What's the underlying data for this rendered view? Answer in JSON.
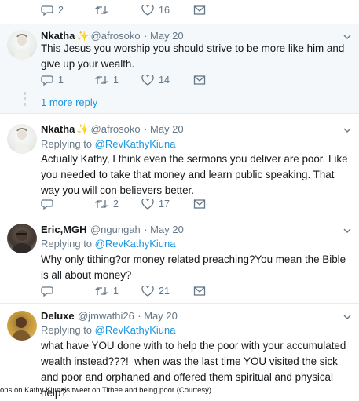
{
  "top_actions": {
    "replies": "2",
    "likes": "16"
  },
  "tweets": [
    {
      "name": "Nkatha",
      "handle": "@afrosoko",
      "date": "· May 20",
      "replying_to": "",
      "text": "This Jesus you worship you should strive to be more like him and give up your wealth.",
      "replies": "1",
      "retweets": "1",
      "likes": "14"
    },
    {
      "name": "Nkatha",
      "handle": "@afrosoko",
      "date": "· May 20",
      "replying_label": "Replying to",
      "replying_to": "@RevKathyKiuna",
      "text": "Actually Kathy, I think even the sermons you deliver are poor. Like you needed to take that money and learn public speaking. That way you will con believers better.",
      "replies": "",
      "retweets": "2",
      "likes": "17"
    },
    {
      "name": "Eric,MGH",
      "handle": "@ngungah",
      "date": "· May 20",
      "replying_label": "Replying to",
      "replying_to": "@RevKathyKiuna",
      "text": "Why only tithing?or money related preaching?You mean the Bible is all about money?",
      "replies": "",
      "retweets": "1",
      "likes": "21"
    },
    {
      "name": "Deluxe",
      "handle": "@jmwathi26",
      "date": "· May 20",
      "replying_label": "Replying to",
      "replying_to": "@RevKathyKiuna",
      "text": "what have YOU done with to help the poor with your accumulated wealth instead???!  when was the last time YOU visited the sick and poor and orphaned and offered them spiritual and physical help?"
    }
  ],
  "more_reply": "1 more reply",
  "caption": "ons on Kathy Kiuna's tweet on Tithee and being poor (Courtesy)",
  "colors": {
    "link": "#1b95e0",
    "meta": "#657786",
    "highlight": "#f5f8fa"
  }
}
